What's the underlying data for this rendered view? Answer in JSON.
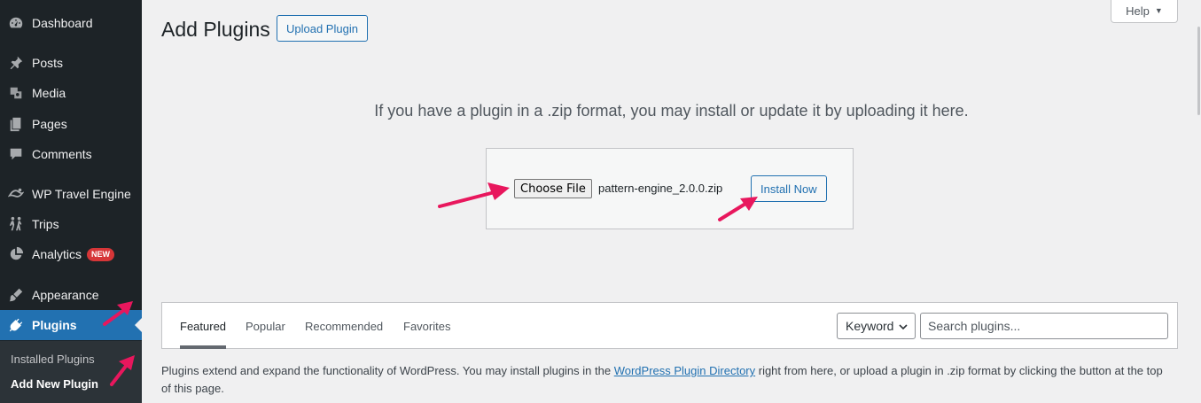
{
  "sidebar": {
    "items": [
      {
        "label": "Dashboard",
        "icon": "dashboard-icon"
      },
      {
        "label": "Posts",
        "icon": "pin-icon"
      },
      {
        "label": "Media",
        "icon": "media-icon"
      },
      {
        "label": "Pages",
        "icon": "pages-icon"
      },
      {
        "label": "Comments",
        "icon": "comment-icon"
      },
      {
        "label": "WP Travel Engine",
        "icon": "travel-icon"
      },
      {
        "label": "Trips",
        "icon": "hikers-icon"
      },
      {
        "label": "Analytics",
        "icon": "pie-chart-icon",
        "badge": "NEW"
      },
      {
        "label": "Appearance",
        "icon": "brush-icon"
      },
      {
        "label": "Plugins",
        "icon": "plugin-icon"
      }
    ],
    "submenu": [
      {
        "label": "Installed Plugins"
      },
      {
        "label": "Add New Plugin"
      }
    ]
  },
  "header": {
    "title": "Add Plugins",
    "upload_button": "Upload Plugin",
    "help_label": "Help"
  },
  "upload": {
    "help_text": "If you have a plugin in a .zip format, you may install or update it by uploading it here.",
    "choose_file_label": "Choose File",
    "file_name": "pattern-engine_2.0.0.zip",
    "install_button": "Install Now"
  },
  "filter": {
    "tabs": [
      "Featured",
      "Popular",
      "Recommended",
      "Favorites"
    ],
    "search_type": "Keyword",
    "search_placeholder": "Search plugins..."
  },
  "description": {
    "before_link": "Plugins extend and expand the functionality of WordPress. You may install plugins in the ",
    "link_text": "WordPress Plugin Directory",
    "after_link": " right from here, or upload a plugin in .zip format by clicking the button at the top of this page."
  },
  "colors": {
    "accent": "#2271b1",
    "sidebar_bg": "#1d2327",
    "annotation_arrow": "#e8175d",
    "badge": "#d63638"
  }
}
